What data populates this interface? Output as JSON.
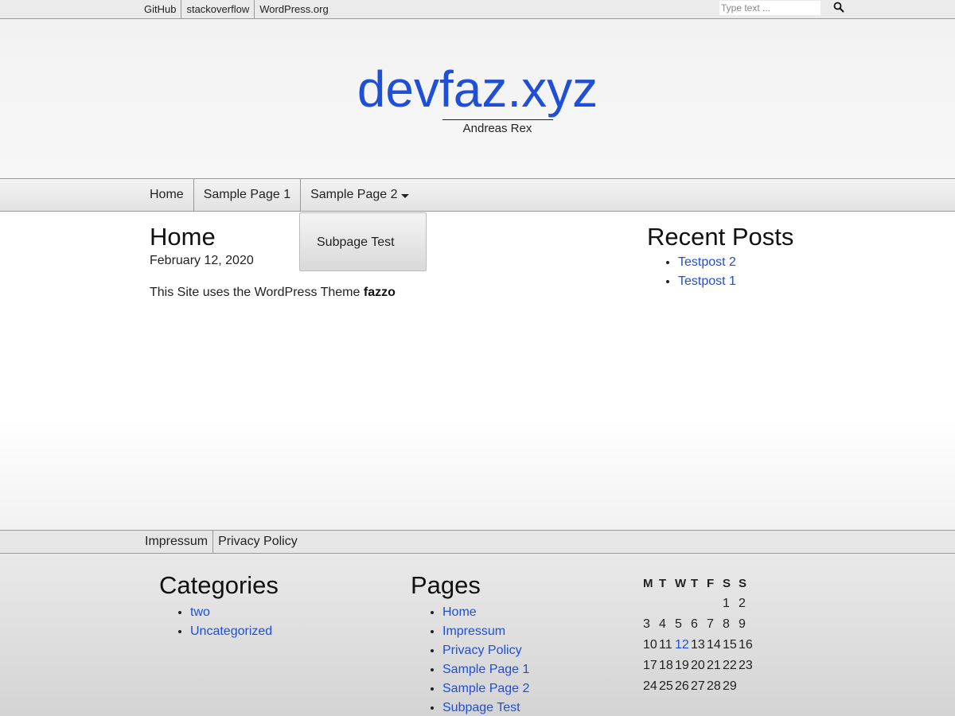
{
  "topbar": {
    "links": [
      "GitHub",
      "stackoverflow",
      "WordPress.org"
    ],
    "search_placeholder": "Type text ..."
  },
  "header": {
    "site_title": "devfaz.xyz",
    "tagline": "Andreas Rex"
  },
  "nav": {
    "items": [
      "Home",
      "Sample Page 1",
      "Sample Page 2"
    ],
    "dropdown_items": [
      "Subpage Test"
    ]
  },
  "main": {
    "heading": "Home",
    "date": "February 12, 2020",
    "body_text": "This Site uses the WordPress Theme ",
    "body_bold": "fazzo"
  },
  "sidebar": {
    "recent_heading": "Recent Posts",
    "recent_posts": [
      "Testpost 2",
      "Testpost 1"
    ]
  },
  "footer_nav": [
    "Impressum",
    "Privacy Policy"
  ],
  "footer": {
    "categories_heading": "Categories",
    "categories": [
      "two",
      "Uncategorized"
    ],
    "pages_heading": "Pages",
    "pages": [
      "Home",
      "Impressum",
      "Privacy Policy",
      "Sample Page 1",
      "Sample Page 2",
      "Subpage Test"
    ]
  },
  "calendar": {
    "weekdays": [
      "M",
      "T",
      "W",
      "T",
      "F",
      "S",
      "S"
    ],
    "weeks": [
      [
        "",
        "",
        "",
        "",
        "",
        "1",
        "2"
      ],
      [
        "3",
        "4",
        "5",
        "6",
        "7",
        "8",
        "9"
      ],
      [
        "10",
        "11",
        "12",
        "13",
        "14",
        "15",
        "16"
      ],
      [
        "17",
        "18",
        "19",
        "20",
        "21",
        "22",
        "23"
      ],
      [
        "24",
        "25",
        "26",
        "27",
        "28",
        "29",
        ""
      ]
    ],
    "linked_day": "12"
  },
  "colors": {
    "link": "#1f4fd6",
    "text": "#222222"
  }
}
